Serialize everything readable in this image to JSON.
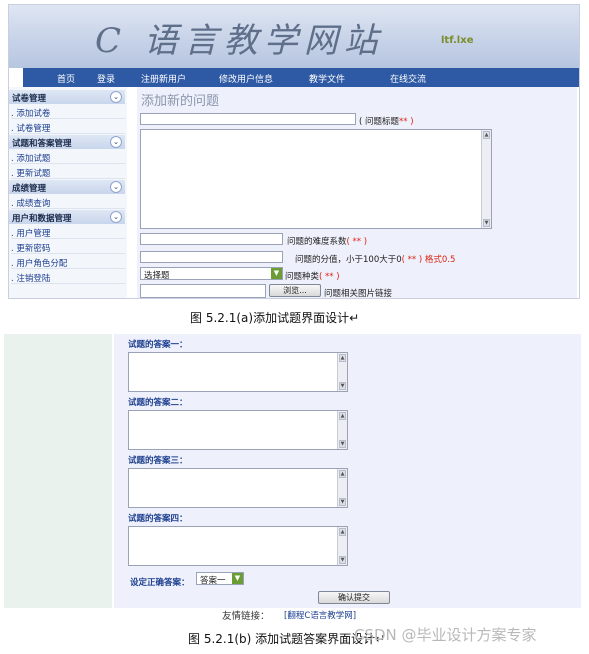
{
  "banner": {
    "title": "C 语言教学网站",
    "badge": "ltf.lxe"
  },
  "nav": [
    "首页",
    "登录",
    "注册新用户",
    "修改用户信息",
    "教学文件",
    "在线交流"
  ],
  "sidebar": {
    "groups": [
      {
        "title": "试卷管理",
        "items": [
          ". 添加试卷",
          ". 试卷管理"
        ]
      },
      {
        "title": "试题和答案管理",
        "items": [
          ". 添加试题",
          ". 更新试题"
        ]
      },
      {
        "title": "成绩管理",
        "items": [
          ". 成绩查询"
        ]
      },
      {
        "title": "用户和数据管理",
        "items": [
          ". 用户管理",
          ". 更新密码",
          ". 用户角色分配",
          ". 注销登陆"
        ]
      }
    ],
    "toggle_icon": "double-chevron-down-icon"
  },
  "form": {
    "page_title": "添加新的问题",
    "title_label": "( 问题标题",
    "required_mark": "** )",
    "difficulty_label": "问题的难度系数",
    "difficulty_req": "( ** )",
    "score_label": "问题的分值，小于100大于0",
    "score_req": "( ** )",
    "score_fmt": "格式0.5",
    "type_value": "选择题",
    "type_label": "问题种类",
    "type_req": "( ** )",
    "browse_button": "浏览...",
    "image_label": "问题相关图片链接"
  },
  "caption_a": "图 5.2.1(a)添加试题界面设计↵",
  "answers": {
    "a1": "试题的答案一：",
    "a2": "试题的答案二：",
    "a3": "试题的答案三：",
    "a4": "试题的答案四：",
    "correct_label": "设定正确答案：",
    "correct_value": "答案一",
    "submit": "确认提交"
  },
  "footer": {
    "links_label": "友情链接：",
    "link": "[翻程C语言教学网]"
  },
  "caption_b": "图 5.2.1(b)  添加试题答案界面设计↵",
  "watermark": "CSDN @毕业设计方案专家",
  "colors": {
    "nav_bg": "#2e5aa5",
    "required": "#d21111",
    "main_bg": "#eef1fb"
  }
}
